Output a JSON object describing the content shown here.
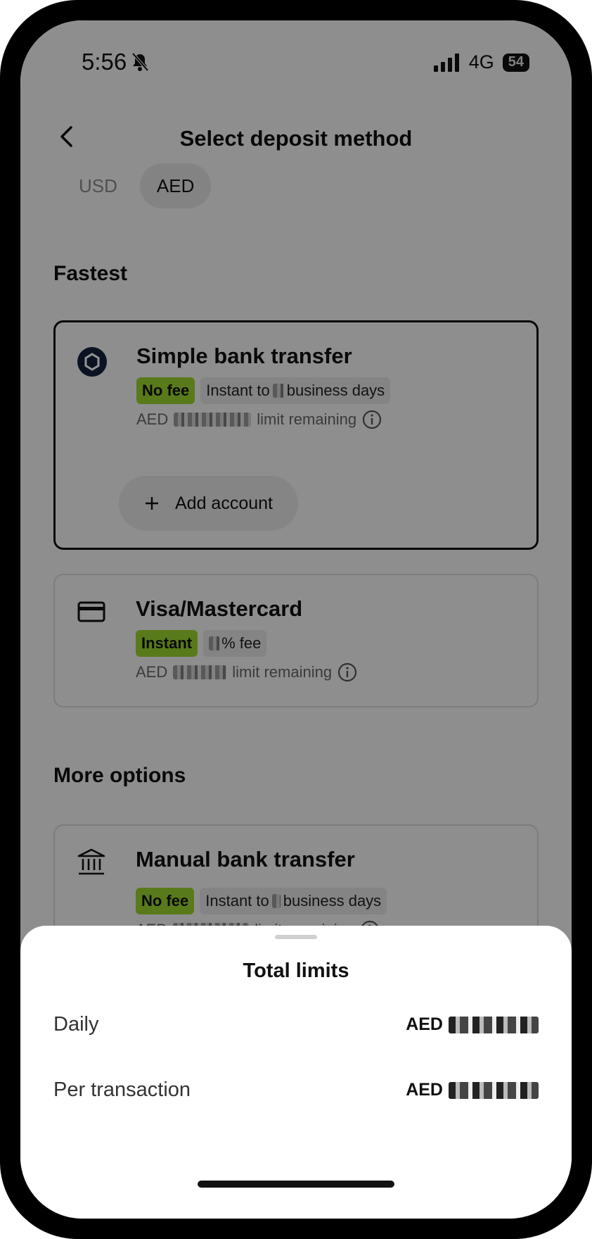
{
  "status_bar": {
    "time": "5:56",
    "network": "4G",
    "battery": "54"
  },
  "header": {
    "title": "Select deposit method"
  },
  "currency_tabs": [
    {
      "label": "USD",
      "active": false
    },
    {
      "label": "AED",
      "active": true
    }
  ],
  "sections": {
    "fastest": "Fastest",
    "more_options": "More options"
  },
  "methods": {
    "simple_bank": {
      "title": "Simple bank transfer",
      "tag_fee": "No fee",
      "tag_speed_prefix": "Instant to",
      "tag_speed_suffix": "business days",
      "limit_prefix": "AED",
      "limit_suffix": "limit remaining",
      "add_account": "Add account"
    },
    "card": {
      "title": "Visa/Mastercard",
      "tag_speed": "Instant",
      "tag_fee_suffix": "% fee",
      "limit_prefix": "AED",
      "limit_suffix": "limit remaining"
    },
    "manual_bank": {
      "title": "Manual bank transfer",
      "tag_fee": "No fee",
      "tag_speed_prefix": "Instant to",
      "tag_speed_suffix": "business days",
      "limit_prefix": "AED",
      "limit_suffix": "limit remaining"
    }
  },
  "sheet": {
    "title": "Total limits",
    "daily_label": "Daily",
    "daily_currency": "AED",
    "per_tx_label": "Per transaction",
    "per_tx_currency": "AED"
  },
  "colors": {
    "accent_green": "#9ad22d",
    "text": "#111111"
  }
}
